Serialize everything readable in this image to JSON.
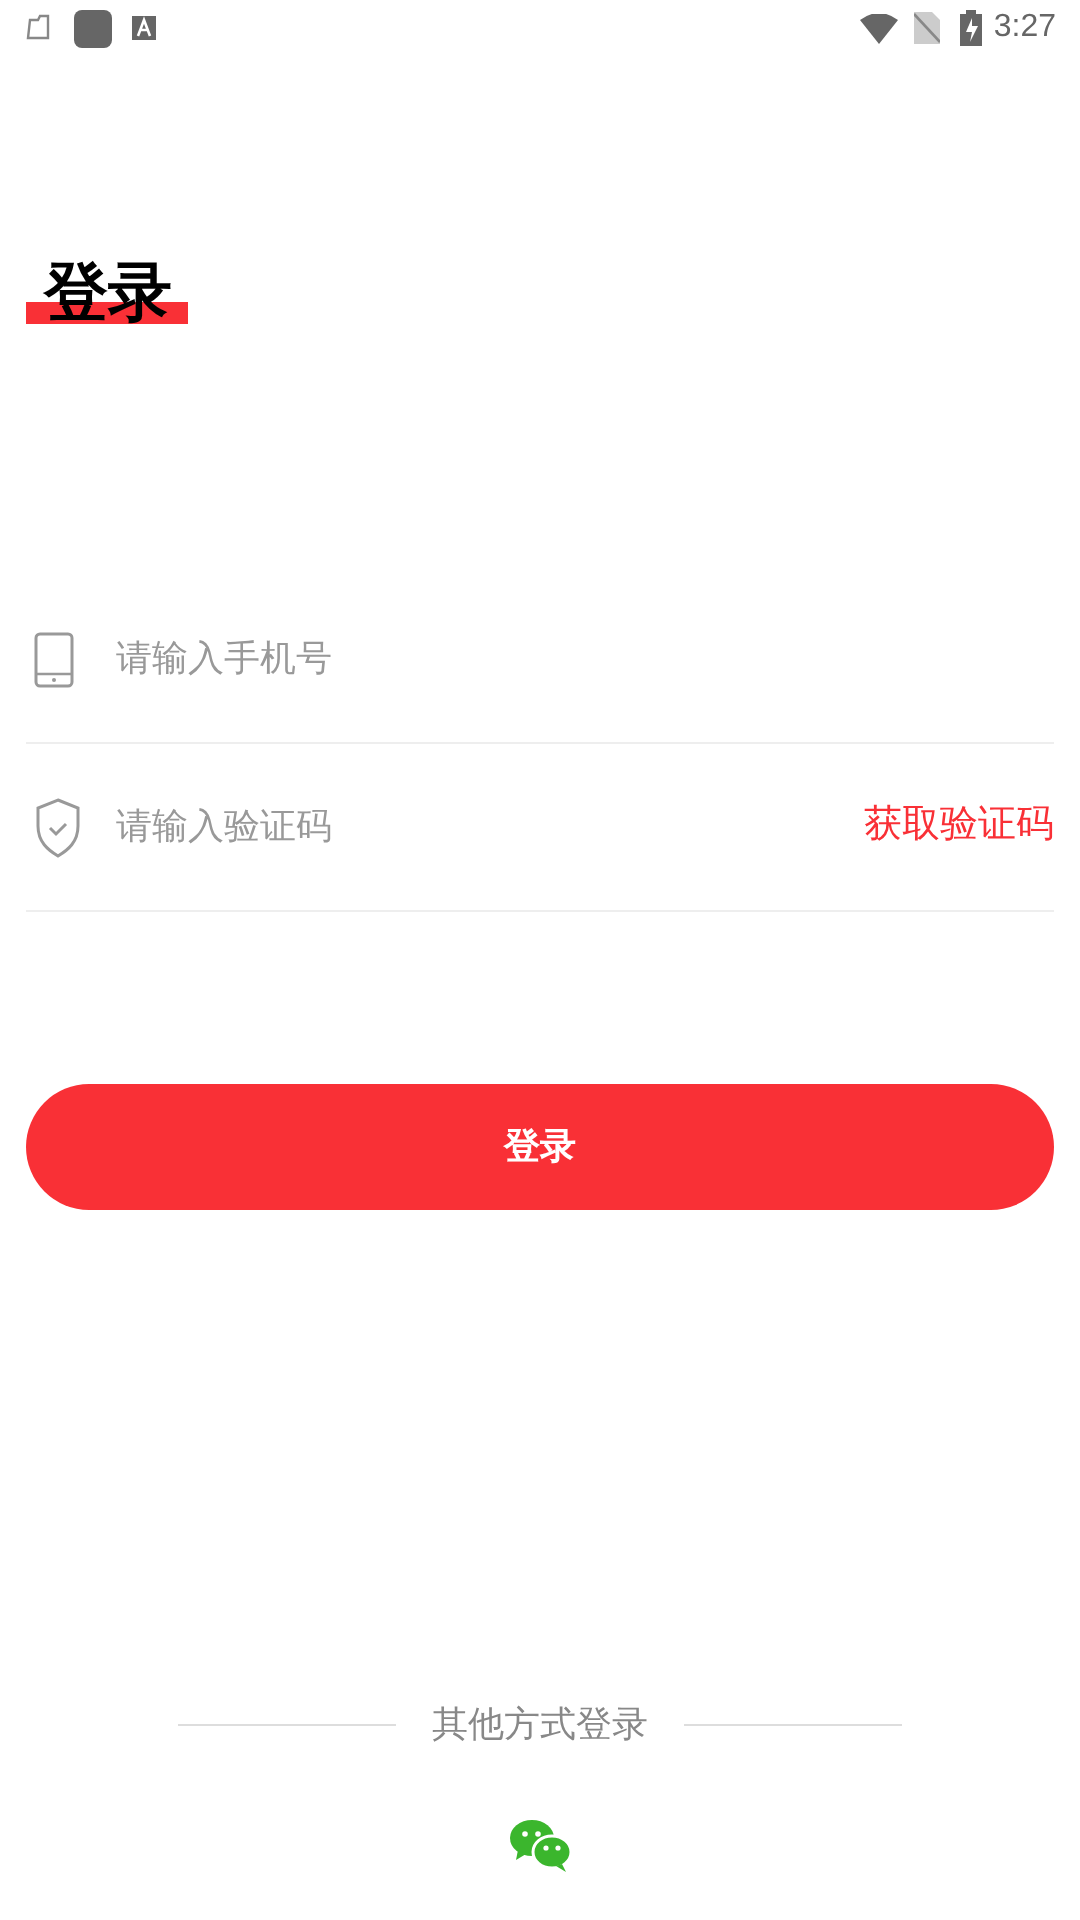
{
  "status_bar": {
    "time": "3:27"
  },
  "title": "登录",
  "fields": [
    {
      "kind": "phone",
      "placeholder": "请输入手机号"
    },
    {
      "kind": "code",
      "placeholder": "请输入验证码",
      "action": "获取验证码"
    }
  ],
  "login_button": "登录",
  "other_login": {
    "label": "其他方式登录"
  }
}
